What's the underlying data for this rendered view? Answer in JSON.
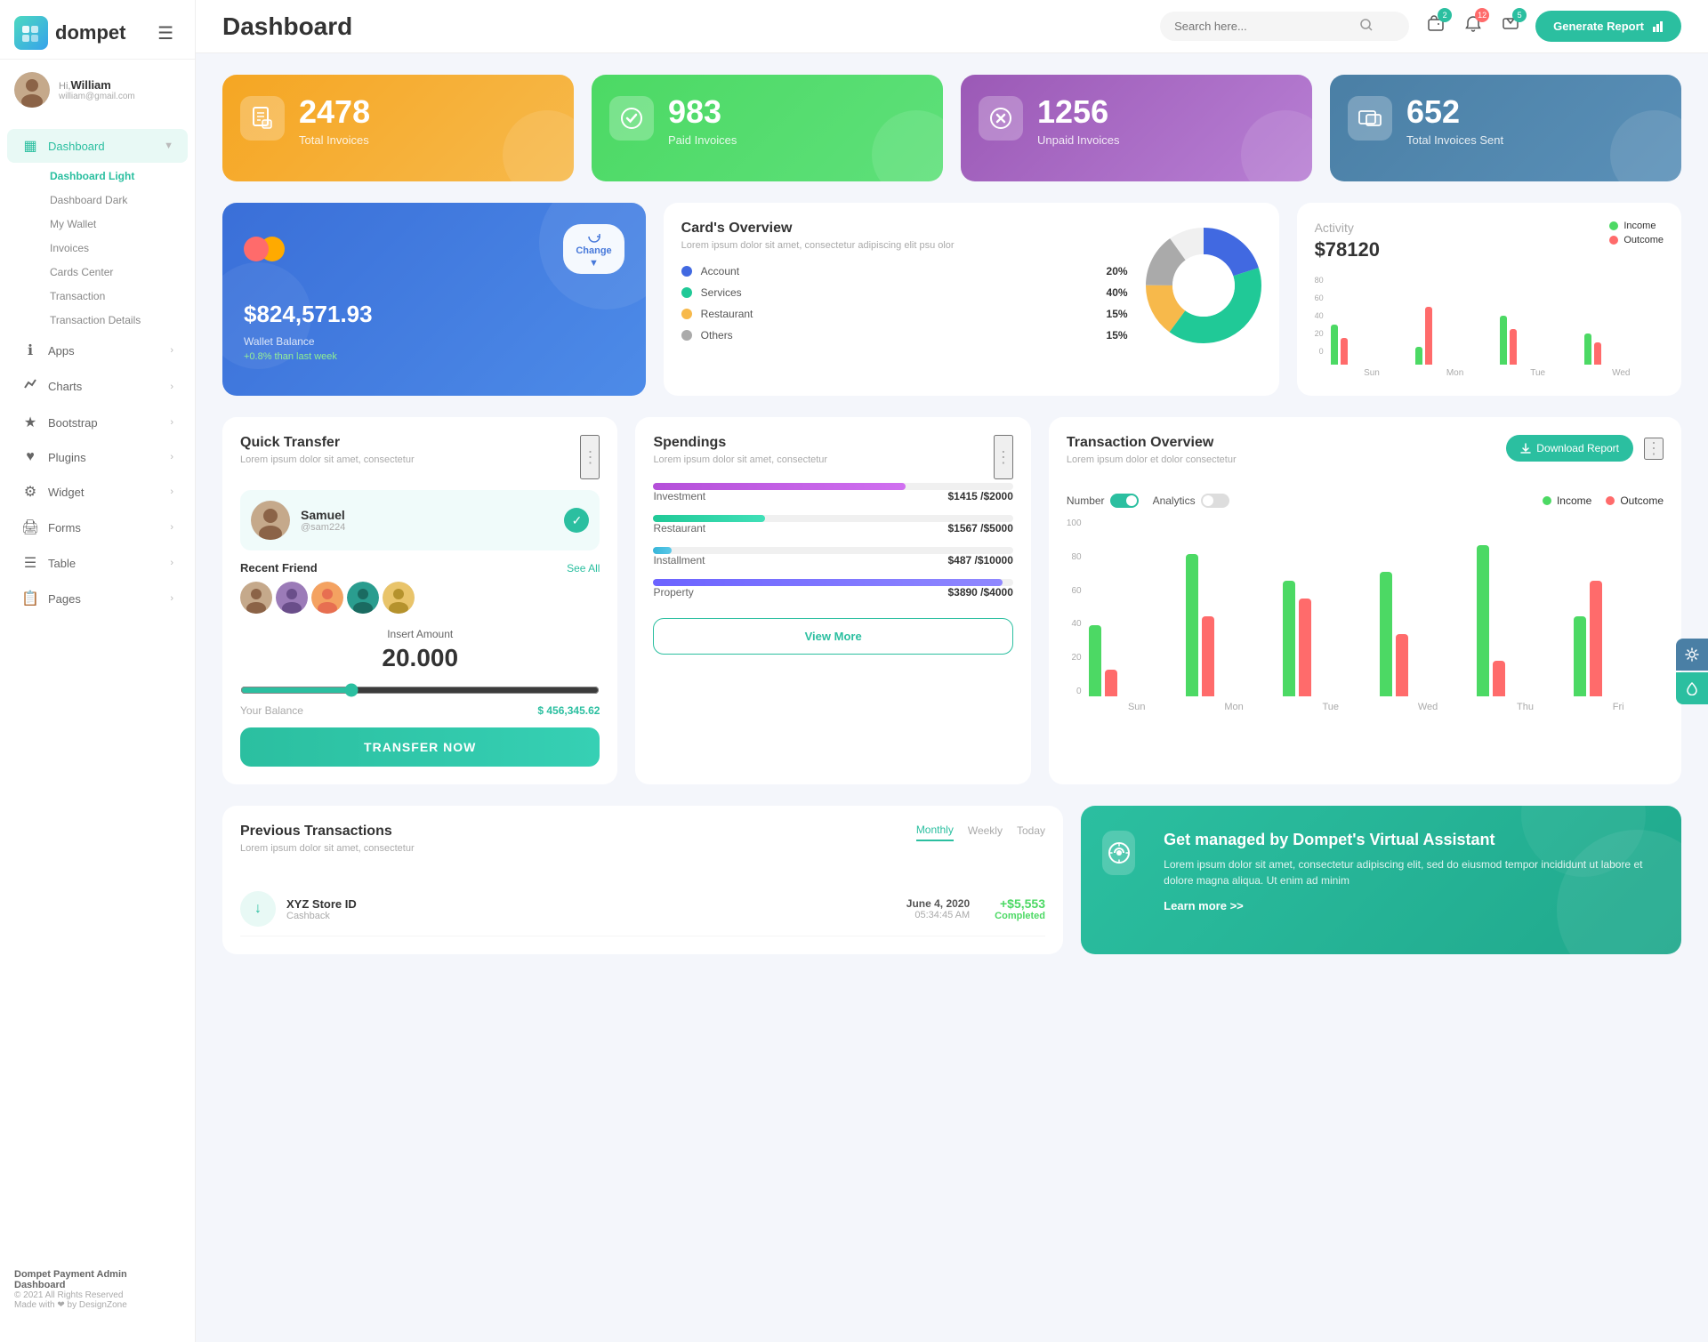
{
  "app": {
    "name": "dompet",
    "tagline": "Dompet Payment Admin Dashboard"
  },
  "header": {
    "title": "Dashboard",
    "search_placeholder": "Search here...",
    "generate_btn": "Generate Report",
    "notifications": [
      {
        "icon": "wallet",
        "count": "2"
      },
      {
        "icon": "bell",
        "count": "12"
      },
      {
        "icon": "chat",
        "count": "5"
      }
    ]
  },
  "user": {
    "greeting": "Hi,",
    "name": "William",
    "email": "william@gmail.com"
  },
  "sidebar": {
    "nav_items": [
      {
        "label": "Dashboard",
        "icon": "▦",
        "active": true,
        "expandable": true
      },
      {
        "label": "Apps",
        "icon": "ℹ",
        "active": false,
        "expandable": true
      },
      {
        "label": "Charts",
        "icon": "📈",
        "active": false,
        "expandable": true
      },
      {
        "label": "Bootstrap",
        "icon": "★",
        "active": false,
        "expandable": true
      },
      {
        "label": "Plugins",
        "icon": "♥",
        "active": false,
        "expandable": true
      },
      {
        "label": "Widget",
        "icon": "⚙",
        "active": false,
        "expandable": true
      },
      {
        "label": "Forms",
        "icon": "🖨",
        "active": false,
        "expandable": true
      },
      {
        "label": "Table",
        "icon": "☰",
        "active": false,
        "expandable": true
      },
      {
        "label": "Pages",
        "icon": "📋",
        "active": false,
        "expandable": true
      }
    ],
    "dashboard_sub": [
      {
        "label": "Dashboard Light",
        "active": true
      },
      {
        "label": "Dashboard Dark",
        "active": false
      },
      {
        "label": "My Wallet",
        "active": false
      },
      {
        "label": "Invoices",
        "active": false
      },
      {
        "label": "Cards Center",
        "active": false
      },
      {
        "label": "Transaction",
        "active": false
      },
      {
        "label": "Transaction Details",
        "active": false
      }
    ],
    "footer": {
      "company": "Dompet Payment Admin Dashboard",
      "copyright": "© 2021 All Rights Reserved",
      "made_with": "Made with ❤ by DesignZone"
    }
  },
  "stat_cards": [
    {
      "number": "2478",
      "label": "Total Invoices",
      "color": "orange",
      "icon": "📄"
    },
    {
      "number": "983",
      "label": "Paid Invoices",
      "color": "green",
      "icon": "✅"
    },
    {
      "number": "1256",
      "label": "Unpaid Invoices",
      "color": "purple",
      "icon": "✗"
    },
    {
      "number": "652",
      "label": "Total Invoices Sent",
      "color": "blue",
      "icon": "📊"
    }
  ],
  "wallet": {
    "amount": "$824,571.93",
    "label": "Wallet Balance",
    "change": "+0.8% than last week",
    "change_btn": "Change"
  },
  "cards_overview": {
    "title": "Card's Overview",
    "subtitle": "Lorem ipsum dolor sit amet, consectetur adipiscing elit psu olor",
    "items": [
      {
        "name": "Account",
        "percent": "20%",
        "color": "#4169e1"
      },
      {
        "name": "Services",
        "percent": "40%",
        "color": "#20c997"
      },
      {
        "name": "Restaurant",
        "percent": "15%",
        "color": "#f7b94b"
      },
      {
        "name": "Others",
        "percent": "15%",
        "color": "#aaaaaa"
      }
    ]
  },
  "activity": {
    "title": "Activity",
    "amount": "$78120",
    "income_label": "Income",
    "outcome_label": "Outcome",
    "bars": [
      {
        "day": "Sun",
        "income": 45,
        "outcome": 30
      },
      {
        "day": "Mon",
        "income": 20,
        "outcome": 65
      },
      {
        "day": "Tue",
        "income": 55,
        "outcome": 40
      },
      {
        "day": "Wed",
        "income": 35,
        "outcome": 25
      }
    ]
  },
  "quick_transfer": {
    "title": "Quick Transfer",
    "subtitle": "Lorem ipsum dolor sit amet, consectetur",
    "selected_contact": {
      "name": "Samuel",
      "handle": "@sam224"
    },
    "recent_friends_label": "Recent Friend",
    "see_all": "See All",
    "amount_label": "Insert Amount",
    "amount_value": "20.000",
    "balance_label": "Your Balance",
    "balance_value": "$ 456,345.62",
    "transfer_btn": "TRANSFER NOW"
  },
  "spendings": {
    "title": "Spendings",
    "subtitle": "Lorem ipsum dolor sit amet, consectetur",
    "items": [
      {
        "name": "Investment",
        "current": "$1415",
        "total": "$2000",
        "percent": 70,
        "color": "#b44fd9"
      },
      {
        "name": "Restaurant",
        "current": "$1567",
        "total": "$5000",
        "percent": 31,
        "color": "#20c997"
      },
      {
        "name": "Installment",
        "current": "$487",
        "total": "$10000",
        "percent": 5,
        "color": "#36b5d8"
      },
      {
        "name": "Property",
        "current": "$3890",
        "total": "$4000",
        "percent": 97,
        "color": "#6c63ff"
      }
    ],
    "view_more_btn": "View More"
  },
  "transaction_overview": {
    "title": "Transaction Overview",
    "subtitle": "Lorem ipsum dolor et dolor consectetur",
    "number_label": "Number",
    "analytics_label": "Analytics",
    "download_btn": "Download Report",
    "income_label": "Income",
    "outcome_label": "Outcome",
    "bars": [
      {
        "day": "Sun",
        "income": 40,
        "outcome": 15
      },
      {
        "day": "Mon",
        "income": 80,
        "outcome": 45
      },
      {
        "day": "Tue",
        "income": 65,
        "outcome": 55
      },
      {
        "day": "Wed",
        "income": 70,
        "outcome": 35
      },
      {
        "day": "Thu",
        "income": 85,
        "outcome": 20
      },
      {
        "day": "Fri",
        "income": 45,
        "outcome": 65
      }
    ]
  },
  "prev_transactions": {
    "title": "Previous Transactions",
    "subtitle": "Lorem ipsum dolor sit amet, consectetur",
    "tabs": [
      "Monthly",
      "Weekly",
      "Today"
    ],
    "active_tab": "Monthly",
    "items": [
      {
        "id": "XYZ Store ID",
        "type": "Cashback",
        "date": "June 4, 2020",
        "time": "05:34:45 AM",
        "amount": "+$5,553",
        "status": "Completed",
        "icon": "↓"
      }
    ]
  },
  "virtual_assistant": {
    "title": "Get managed by Dompet's Virtual Assistant",
    "text": "Lorem ipsum dolor sit amet, consectetur adipiscing elit, sed do eiusmod tempor incididunt ut labore et dolore magna aliqua. Ut enim ad minim",
    "link": "Learn more >>",
    "icon": "💰"
  }
}
